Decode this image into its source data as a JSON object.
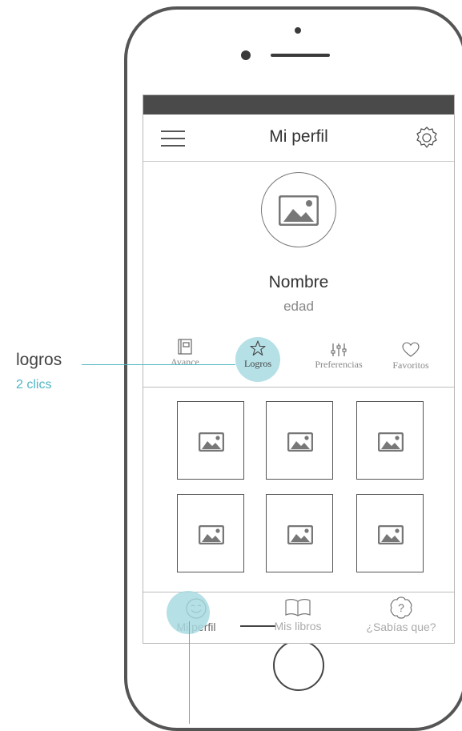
{
  "header": {
    "title": "Mi perfil"
  },
  "icons": {
    "menu": "hamburger-icon",
    "settings": "gear-icon",
    "avatar": "image-placeholder-icon"
  },
  "profile": {
    "name": "Nombre",
    "age": "edad"
  },
  "tabs": [
    {
      "label": "Avance",
      "icon": "notebook-icon"
    },
    {
      "label": "Logros",
      "icon": "star-icon",
      "selected": true
    },
    {
      "label": "Preferencias",
      "icon": "sliders-icon"
    },
    {
      "label": "Favoritos",
      "icon": "heart-icon"
    }
  ],
  "grid": {
    "items": 6,
    "item_icon": "image-placeholder-icon"
  },
  "bottom_nav": [
    {
      "label": "Mi perfil",
      "icon": "smiley-icon",
      "active": true
    },
    {
      "label": "Mis libros",
      "icon": "book-icon"
    },
    {
      "label": "¿Sabías que?",
      "icon": "question-badge-icon"
    }
  ],
  "annotation": {
    "label": "logros",
    "detail": "2 clics",
    "color": "#4fb6c4",
    "highlight_color": "#a8dbe2"
  }
}
